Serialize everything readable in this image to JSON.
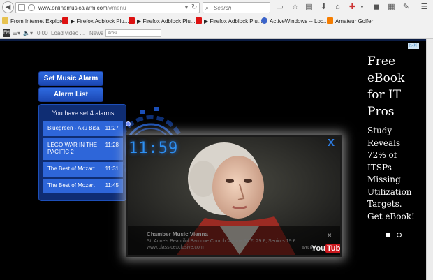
{
  "browser": {
    "url_host": "www.onlinemusicalarm.com",
    "url_path": "/#menu",
    "search_placeholder": "Search"
  },
  "bookmarks": [
    {
      "label": "From Internet Explorer",
      "icon": "folder-icon"
    },
    {
      "label": "▶ Firefox Adblock Plu...",
      "icon": "youtube-icon"
    },
    {
      "label": "▶ Firefox Adblock Plu...",
      "icon": "youtube-icon"
    },
    {
      "label": "▶ Firefox Adblock Plu...",
      "icon": "youtube-icon"
    },
    {
      "label": "ActiveWindows -- Loc...",
      "icon": "activewindows-icon"
    },
    {
      "label": "Amateur Golfer",
      "icon": "blogger-icon"
    }
  ],
  "addon_bar": {
    "time": "0:00",
    "load_label": "Load video ...",
    "news_label": "News",
    "artist_placeholder": "Artist"
  },
  "app": {
    "set_alarm_label": "Set Music Alarm",
    "alarm_list_label": "Alarm List",
    "alarm_count_text": "You have set 4 alarms",
    "alarms": [
      {
        "name": "Bluegreen - Aku Bisa",
        "time": "11:27"
      },
      {
        "name": "LEGO WAR IN THE PACIFIC 2",
        "time": "11:28"
      },
      {
        "name": "The Best of Mozart",
        "time": "11:31"
      },
      {
        "name": "The Best of Mozart",
        "time": "11:45"
      }
    ],
    "clock_time": "11:59"
  },
  "video": {
    "close_label": "X",
    "ad_close": "×",
    "ad_title": "Chamber Music Vienna",
    "ad_line": "St. Anne's Beautiful Baroque Church Vienna 39 €, 29 €, Seniors 19 €",
    "ad_url": "www.classicexclusive.com",
    "ads_by": "Ads by",
    "yt_you": "You",
    "yt_tube": "Tube"
  },
  "side_ad": {
    "title_lines": [
      "Free",
      "eBook",
      "for IT",
      "Pros"
    ],
    "body_lines": [
      "Study",
      "Reveals",
      "72% of",
      "ITSPs",
      "Missing",
      "Utilization",
      "Targets.",
      "Get eBook!"
    ],
    "badge": "▷✕"
  },
  "colors": {
    "button_blue": "#2f6be0",
    "panel_blue": "#12378c",
    "clock_blue": "#2e8ff0",
    "page_bg": "#000000"
  }
}
